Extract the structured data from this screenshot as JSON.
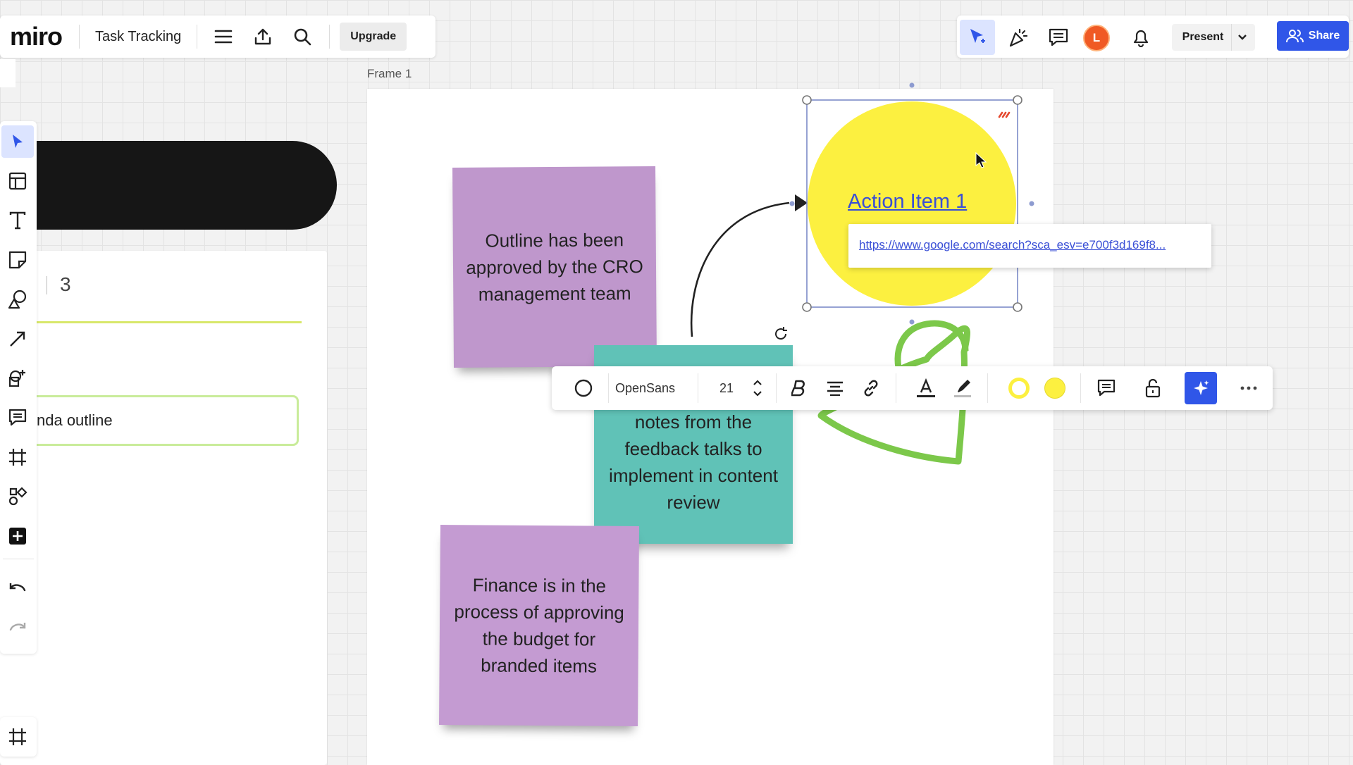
{
  "app": {
    "logo_text": "miro",
    "board_title": "Task Tracking",
    "upgrade_label": "Upgrade",
    "present_label": "Present",
    "share_label": "Share",
    "avatar_initial": "L",
    "colors": {
      "accent": "#3056e8",
      "selection": "#7c8ac8",
      "avatar": "#f05a24"
    }
  },
  "left_panel": {
    "count": "3",
    "field_value": "nda outline"
  },
  "frame": {
    "label": "Frame 1"
  },
  "stickies": [
    {
      "text": "Outline has been approved by the CRO management team",
      "color": "#bf97cc"
    },
    {
      "text": "notes from the feedback talks to implement in content review",
      "color": "#60c2b7"
    },
    {
      "text": "Finance is in the process of approving the budget for branded items",
      "color": "#c49bd2"
    }
  ],
  "action_item": {
    "title": "Action Item 1",
    "link": "https://www.google.com/search?sca_esv=e700f3d169f8...",
    "fill": "#fcf040"
  },
  "format_toolbar": {
    "font_name": "OpenSans",
    "font_size": "21",
    "border_color": "#fcf040",
    "fill_color": "#fcf040",
    "ai_color": "#3056e8"
  }
}
